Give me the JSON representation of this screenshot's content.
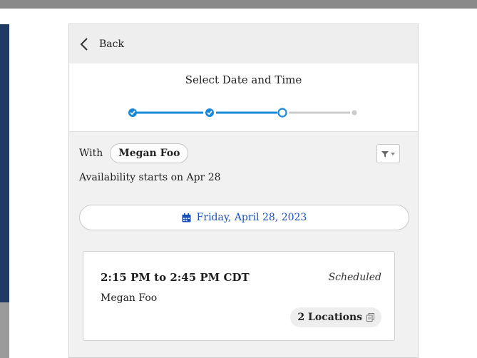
{
  "nav": {
    "back_label": "Back"
  },
  "header": {
    "title": "Select Date and Time",
    "steps_total": 4,
    "steps_completed": 2,
    "current_step": 3
  },
  "filter": {
    "with_label": "With",
    "person_name": "Megan Foo"
  },
  "availability_text": "Availability starts on Apr 28",
  "date_selector": {
    "label": "Friday, April 28, 2023"
  },
  "slot": {
    "time": "2:15 PM to 2:45 PM CDT",
    "status": "Scheduled",
    "person": "Megan Foo",
    "locations_label": "2 Locations"
  },
  "colors": {
    "accent": "#1a8ad8",
    "link": "#1a4fb8",
    "inactive": "#cccccc"
  },
  "icons": [
    "chevron-left-icon",
    "check-icon",
    "filter-icon",
    "caret-down-icon",
    "calendar-icon",
    "copy-icon"
  ]
}
